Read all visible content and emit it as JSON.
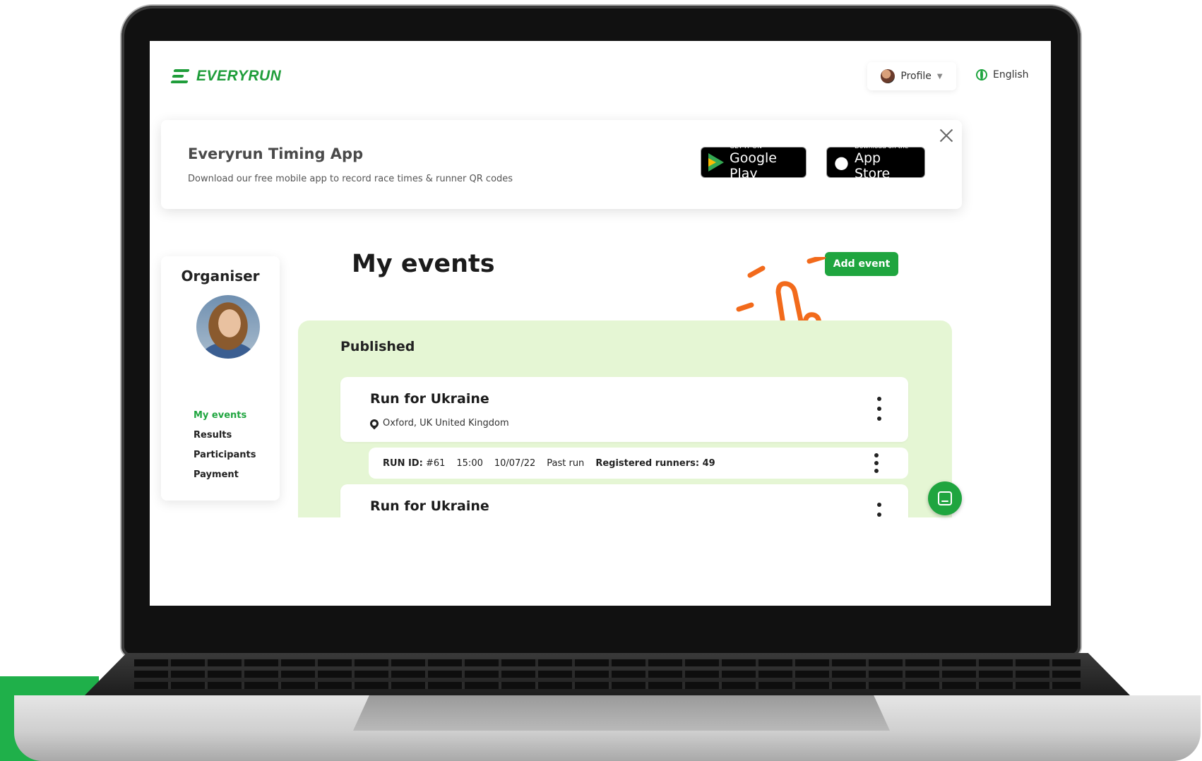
{
  "header": {
    "logo_text": "EVERYRUN",
    "profile_label": "Profile",
    "language_label": "English"
  },
  "banner": {
    "title": "Everyrun Timing App",
    "subtitle": "Download our free mobile app to record race times & runner QR codes",
    "google_play": {
      "small": "GET IT ON",
      "big": "Google Play"
    },
    "app_store": {
      "small": "Download on the",
      "big": "App Store"
    }
  },
  "sidebar": {
    "title": "Organiser",
    "items": [
      {
        "label": "My events",
        "active": true
      },
      {
        "label": "Results",
        "active": false
      },
      {
        "label": "Participants",
        "active": false
      },
      {
        "label": "Payment",
        "active": false
      }
    ]
  },
  "main": {
    "title": "My events",
    "add_button": "Add event",
    "section_title": "Published",
    "events": [
      {
        "name": "Run for Ukraine",
        "location": "Oxford, UK United Kingdom",
        "run": {
          "id_label": "RUN ID:",
          "id_value": "#61",
          "time": "15:00",
          "date": "10/07/22",
          "status": "Past run",
          "runners_label": "Registered runners: 49"
        }
      },
      {
        "name": "Run for Ukraine"
      }
    ]
  },
  "colors": {
    "brand_green": "#1fa53f",
    "published_bg": "#e5f6d4",
    "annotation_orange": "#f26a1b"
  },
  "icons": [
    "menu-lines-icon",
    "globe-icon",
    "caret-down-icon",
    "close-icon",
    "google-play-icon",
    "apple-icon",
    "location-pin-icon",
    "kebab-menu-icon",
    "chat-icon",
    "hand-pointer-icon"
  ]
}
